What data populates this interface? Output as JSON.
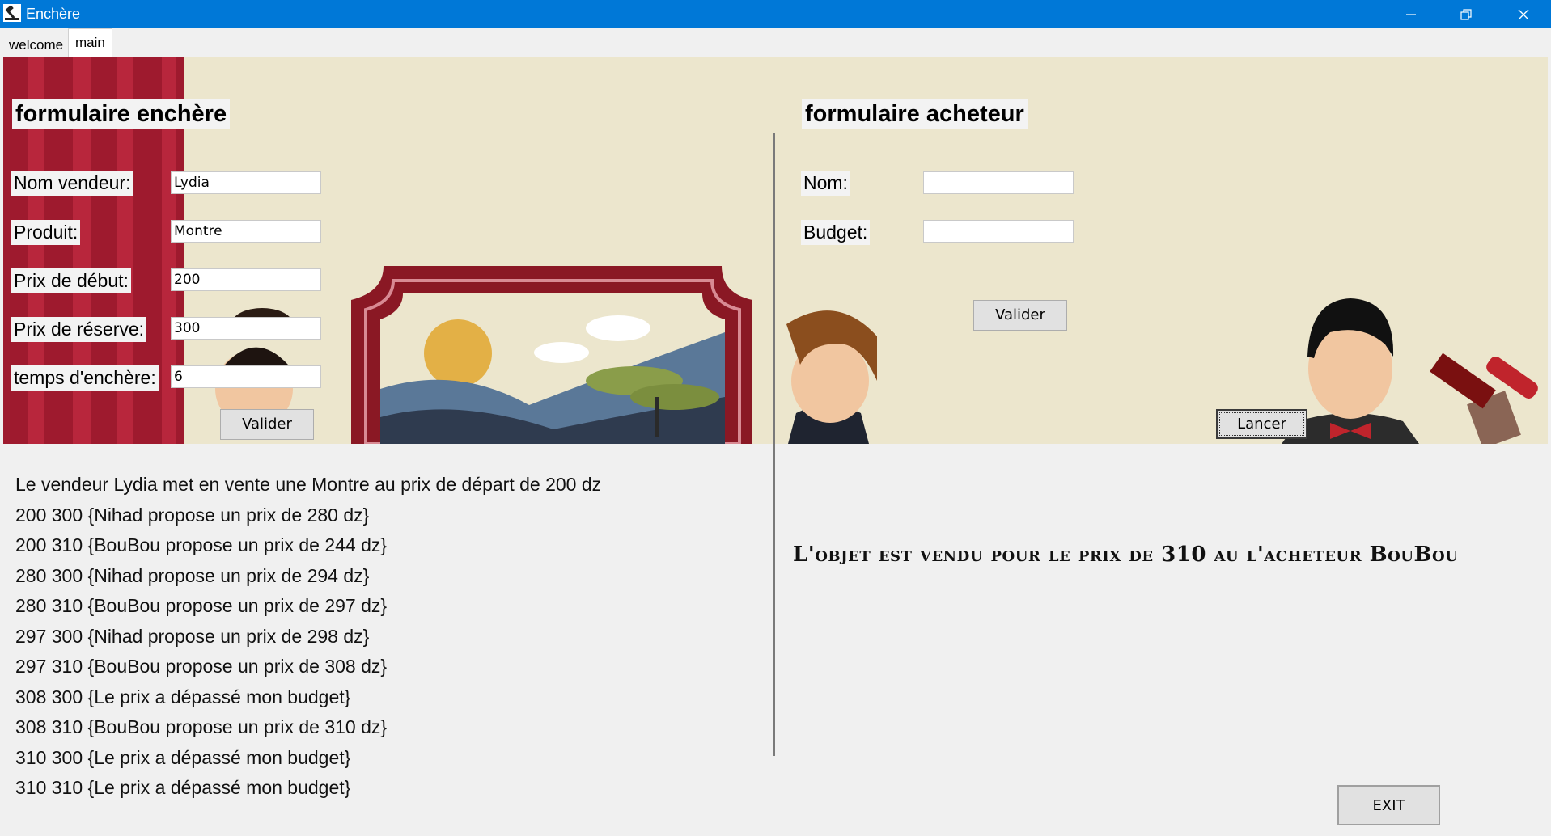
{
  "window": {
    "title": "Enchère"
  },
  "tabs": [
    {
      "label": "welcome"
    },
    {
      "label": "main"
    }
  ],
  "seller_form": {
    "title": "formulaire enchère",
    "fields": [
      {
        "label": "Nom vendeur:",
        "value": "Lydia"
      },
      {
        "label": "Produit:",
        "value": "Montre"
      },
      {
        "label": "Prix de début:",
        "value": "200"
      },
      {
        "label": "Prix de réserve:",
        "value": "300"
      },
      {
        "label": "temps d'enchère:",
        "value": "6"
      }
    ],
    "submit_label": "Valider"
  },
  "buyer_form": {
    "title": "formulaire acheteur",
    "fields": [
      {
        "label": "Nom:",
        "value": ""
      },
      {
        "label": "Budget:",
        "value": ""
      }
    ],
    "submit_label": "Valider",
    "launch_label": "Lancer"
  },
  "log": [
    "Le vendeur Lydia met en vente une Montre au prix de départ de 200 dz",
    "200 300 {Nihad propose un prix de 280 dz}",
    "200 310 {BouBou propose un prix de 244 dz}",
    "280 300 {Nihad propose un prix de 294 dz}",
    "280 310 {BouBou propose un prix de 297 dz}",
    "297 300 {Nihad propose un prix de 298 dz}",
    "297 310 {BouBou propose un prix de 308 dz}",
    "308 300 {Le prix a dépassé mon budget}",
    "308 310 {BouBou propose un prix de 310 dz}",
    "310 300 {Le prix a dépassé mon budget}",
    "310 310 {Le prix a dépassé mon budget}"
  ],
  "result": "L'objet est vendu pour le prix de 310 au l'acheteur BouBou",
  "exit_label": "EXIT",
  "icons": {
    "app": "gavel-icon",
    "minimize": "minimize-icon",
    "restore": "restore-icon",
    "close": "close-icon"
  },
  "colors": {
    "titlebar": "#0078d7",
    "curtain": "#9e1a2e",
    "scene_background": "#ece6cd",
    "frame": "#8a1824"
  }
}
